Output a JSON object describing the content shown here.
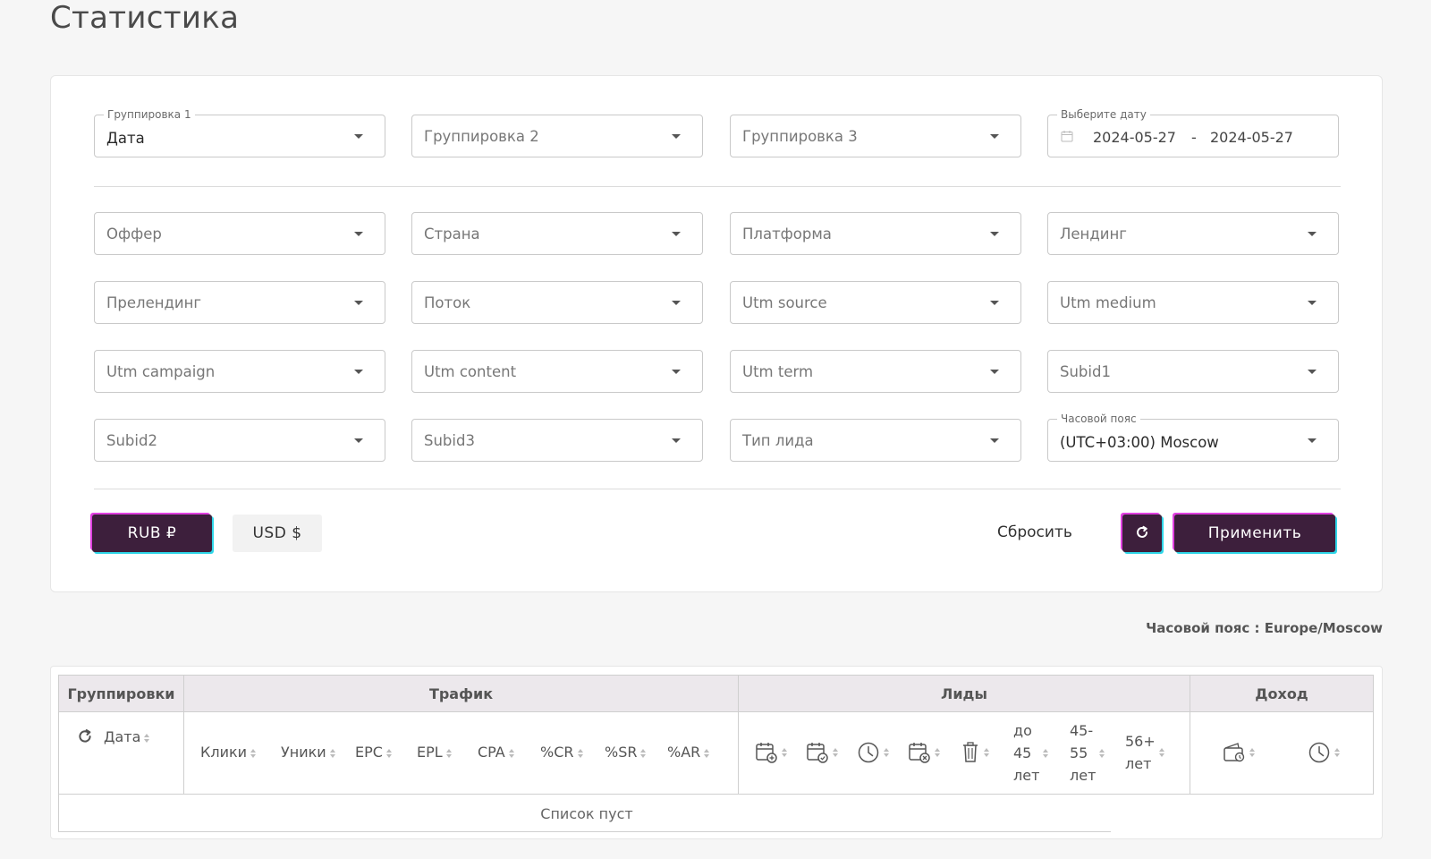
{
  "page": {
    "title": "Статистика"
  },
  "grouping": {
    "g1": {
      "label": "Группировка 1",
      "value": "Дата"
    },
    "g2": {
      "placeholder": "Группировка 2"
    },
    "g3": {
      "placeholder": "Группировка 3"
    },
    "date": {
      "label": "Выберите дату",
      "from": "2024-05-27",
      "sep": "-",
      "to": "2024-05-27"
    }
  },
  "filters": [
    "Оффер",
    "Страна",
    "Платформа",
    "Лендинг",
    "Прелендинг",
    "Поток",
    "Utm source",
    "Utm medium",
    "Utm campaign",
    "Utm content",
    "Utm term",
    "Subid1",
    "Subid2",
    "Subid3",
    "Тип лида"
  ],
  "timezone_select": {
    "label": "Часовой пояс",
    "value": "(UTC+03:00) Moscow"
  },
  "actions": {
    "rub": "RUB ₽",
    "usd": "USD $",
    "reset": "Сбросить",
    "apply": "Применить"
  },
  "timezone_note": "Часовой пояс : Europe/Moscow",
  "table": {
    "groups": [
      "Группировки",
      "Трафик",
      "Лиды",
      "Доход"
    ],
    "grouping_col": "Дата",
    "traffic_cols": [
      "Клики",
      "Уники",
      "EPC",
      "EPL",
      "CPA",
      "%CR",
      "%SR",
      "%AR"
    ],
    "lead_icons": [
      "calendar-plus-icon",
      "calendar-check-icon",
      "clock-icon",
      "calendar-x-icon",
      "trash-icon"
    ],
    "age_cols": [
      {
        "l1": "до",
        "l2": "45",
        "l3": "лет"
      },
      {
        "l1": "45-",
        "l2": "55",
        "l3": "лет"
      },
      {
        "l1": "56+",
        "l2": "лет"
      }
    ],
    "income_icons": [
      "wallet-icon",
      "clock-icon"
    ],
    "empty": "Список пуст"
  }
}
